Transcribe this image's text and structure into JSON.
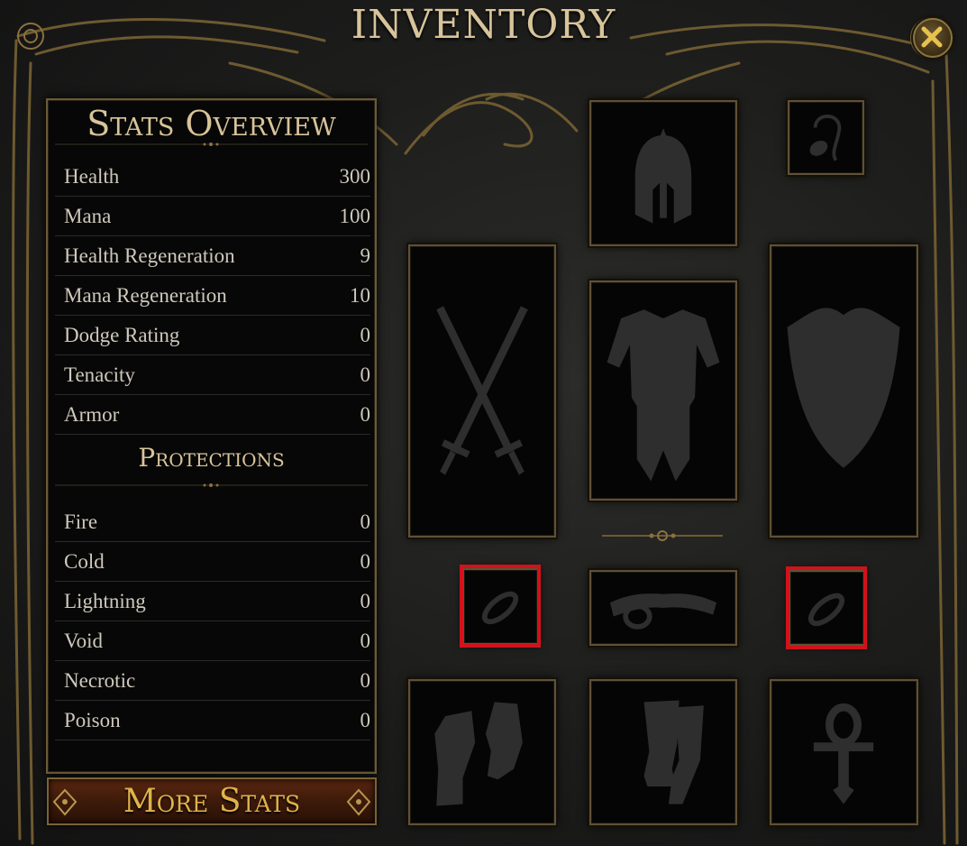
{
  "window": {
    "title": "INVENTORY",
    "close_icon": "close-x-icon"
  },
  "stats_panel": {
    "heading": "Stats Overview",
    "stats": [
      {
        "label": "Health",
        "value": "300"
      },
      {
        "label": "Mana",
        "value": "100"
      },
      {
        "label": "Health Regeneration",
        "value": "9"
      },
      {
        "label": "Mana Regeneration",
        "value": "10"
      },
      {
        "label": "Dodge Rating",
        "value": "0"
      },
      {
        "label": "Tenacity",
        "value": "0"
      },
      {
        "label": "Armor",
        "value": "0"
      }
    ],
    "protections_heading": "Protections",
    "protections": [
      {
        "label": "Fire",
        "value": "0"
      },
      {
        "label": "Cold",
        "value": "0"
      },
      {
        "label": "Lightning",
        "value": "0"
      },
      {
        "label": "Void",
        "value": "0"
      },
      {
        "label": "Necrotic",
        "value": "0"
      },
      {
        "label": "Poison",
        "value": "0"
      }
    ]
  },
  "more_stats_button": {
    "label": "More Stats"
  },
  "equipment_slots": [
    {
      "slot": "helmet",
      "icon": "helmet-icon",
      "highlighted": false
    },
    {
      "slot": "amulet",
      "icon": "amulet-icon",
      "highlighted": false
    },
    {
      "slot": "weapon",
      "icon": "crossed-swords-icon",
      "highlighted": false
    },
    {
      "slot": "body-armor",
      "icon": "body-armor-icon",
      "highlighted": false
    },
    {
      "slot": "off-hand",
      "icon": "shield-icon",
      "highlighted": false
    },
    {
      "slot": "ring-left",
      "icon": "ring-icon",
      "highlighted": true
    },
    {
      "slot": "belt",
      "icon": "belt-icon",
      "highlighted": false
    },
    {
      "slot": "ring-right",
      "icon": "ring-icon",
      "highlighted": true
    },
    {
      "slot": "gloves",
      "icon": "gloves-icon",
      "highlighted": false
    },
    {
      "slot": "boots",
      "icon": "boots-icon",
      "highlighted": false
    },
    {
      "slot": "relic",
      "icon": "ankh-icon",
      "highlighted": false
    }
  ],
  "colors": {
    "gold_text": "#d8c49a",
    "button_text": "#e0b24a",
    "frame_gold": "#6b5a36",
    "highlight_red": "#d0121b",
    "icon_silhouette": "#2e2e2e"
  }
}
